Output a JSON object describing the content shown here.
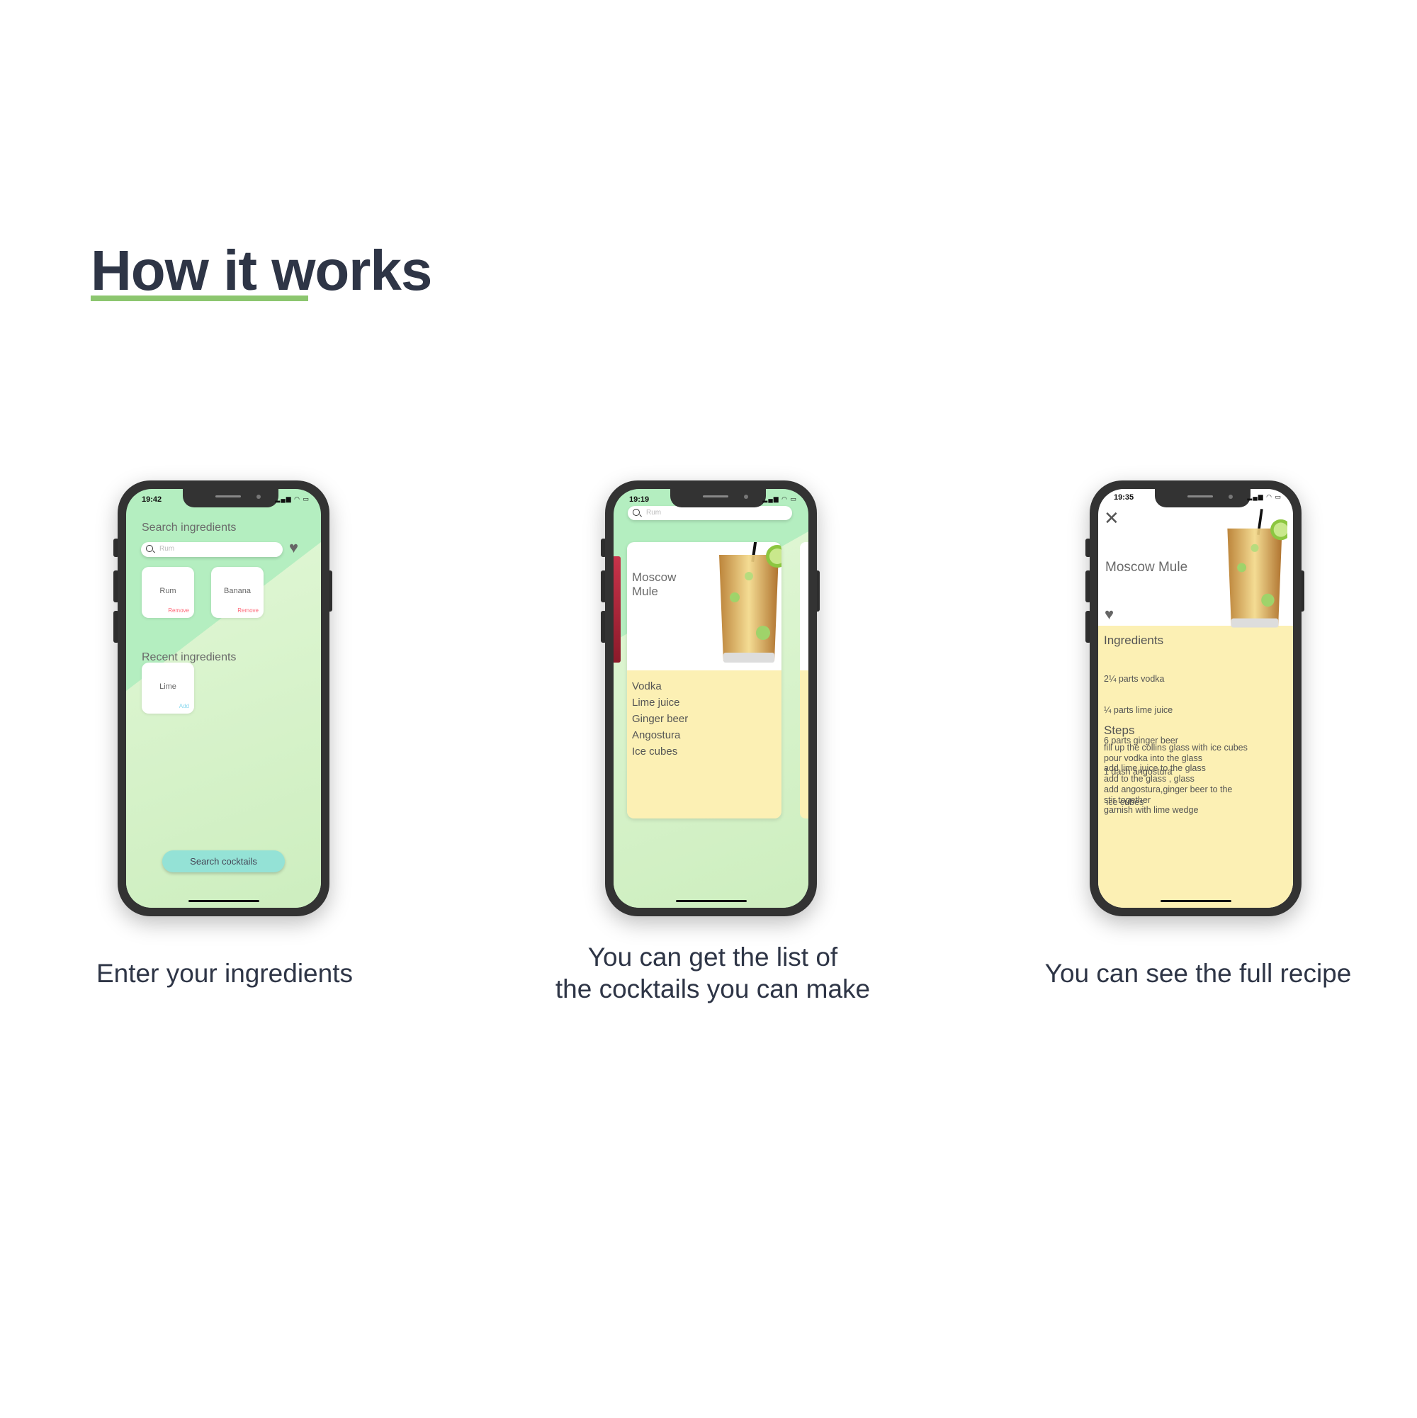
{
  "heading": "How it works",
  "accent_color": "#8cc66f",
  "steps": [
    {
      "caption": "Enter your ingredients"
    },
    {
      "caption_line1": "You can get the list of",
      "caption_line2": "the cocktails you can make"
    },
    {
      "caption": "You can see the full recipe"
    }
  ],
  "screen1": {
    "time": "19:42",
    "search_label": "Search ingredients",
    "search_placeholder": "Rum",
    "selected": [
      {
        "name": "Rum",
        "action": "Remove"
      },
      {
        "name": "Banana",
        "action": "Remove"
      }
    ],
    "recent_label": "Recent ingredients",
    "recent": [
      {
        "name": "Lime",
        "action": "Add"
      }
    ],
    "button": "Search cocktails"
  },
  "screen2": {
    "time": "19:19",
    "search_placeholder": "Rum",
    "cocktail_line1": "Moscow",
    "cocktail_line2": "Mule",
    "ingredients": [
      "Vodka",
      "Lime juice",
      "Ginger beer",
      "Angostura",
      "Ice cubes"
    ]
  },
  "screen3": {
    "time": "19:35",
    "title": "Moscow Mule",
    "ingredients_label": "Ingredients",
    "ingredients": [
      "2¼ parts vodka",
      "¼ parts lime juice",
      "6 parts ginger beer",
      "1 dash angostura",
      " ice cubes"
    ],
    "steps_label": "Steps",
    "steps": [
      "fill up the collins glass with ice cubes",
      "pour vodka into the glass",
      "add lime juice to the glass",
      "add to the glass , glass",
      "add angostura,ginger beer to the",
      "stir together",
      "garnish with lime wedge"
    ]
  }
}
